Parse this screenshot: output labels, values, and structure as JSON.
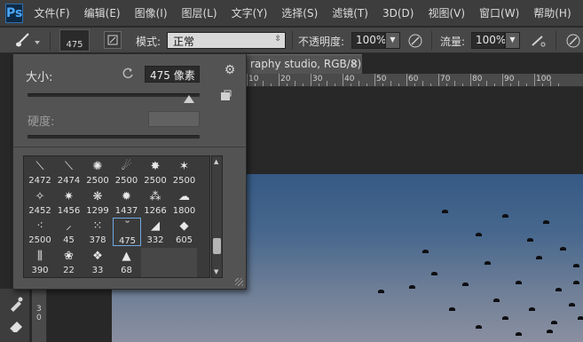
{
  "app": {
    "logo": "Ps"
  },
  "menu": [
    "文件(F)",
    "编辑(E)",
    "图像(I)",
    "图层(L)",
    "文字(Y)",
    "选择(S)",
    "滤镜(T)",
    "3D(D)",
    "视图(V)",
    "窗口(W)",
    "帮助(H)"
  ],
  "options": {
    "brush_size": "475",
    "mode_label": "模式:",
    "mode_value": "正常",
    "opacity_label": "不透明度:",
    "opacity_value": "100%",
    "flow_label": "流量:",
    "flow_value": "100%"
  },
  "document": {
    "tab_title": "raphy studio, RGB/8)",
    "tab_close": "×",
    "ruler_h": [
      "10",
      "20",
      "30",
      "40",
      "50",
      "60",
      "70",
      "80",
      "90",
      "100"
    ],
    "ruler_v": [
      "3",
      "0"
    ]
  },
  "brush_panel": {
    "size_label": "大小:",
    "size_value": "475 像素",
    "size_fraction": 0.94,
    "hardness_label": "硬度:",
    "hardness_fraction": 1.0,
    "gear_icon": "⚙",
    "presets": [
      {
        "num": "2472",
        "icon": "streak-brush-icon",
        "glyph": "⟍"
      },
      {
        "num": "2474",
        "icon": "streak-brush-icon",
        "glyph": "⟍"
      },
      {
        "num": "2500",
        "icon": "splatter-brush-icon",
        "glyph": "✺"
      },
      {
        "num": "2500",
        "icon": "comet-brush-icon",
        "glyph": "☄"
      },
      {
        "num": "2500",
        "icon": "splatter-brush-icon",
        "glyph": "✸"
      },
      {
        "num": "2500",
        "icon": "star-burst-brush-icon",
        "glyph": "✶"
      },
      {
        "num": "2452",
        "icon": "streak-brush-icon",
        "glyph": "✧"
      },
      {
        "num": "1456",
        "icon": "star-burst-brush-icon",
        "glyph": "✷"
      },
      {
        "num": "1299",
        "icon": "splatter-brush-icon",
        "glyph": "❋"
      },
      {
        "num": "1437",
        "icon": "splatter-brush-icon",
        "glyph": "✹"
      },
      {
        "num": "1266",
        "icon": "splatter-brush-icon",
        "glyph": "⁂"
      },
      {
        "num": "1800",
        "icon": "smoke-brush-icon",
        "glyph": "☁"
      },
      {
        "num": "2500",
        "icon": "cloud-brush-icon",
        "glyph": "⁖"
      },
      {
        "num": "45",
        "icon": "feather-brush-icon",
        "glyph": "⸝"
      },
      {
        "num": "378",
        "icon": "birds-brush-icon",
        "glyph": "⁙"
      },
      {
        "num": "475",
        "icon": "birds-brush-icon",
        "glyph": "˘"
      },
      {
        "num": "332",
        "icon": "birds-brush-icon",
        "glyph": "◢"
      },
      {
        "num": "605",
        "icon": "shard-brush-icon",
        "glyph": "◆"
      },
      {
        "num": "390",
        "icon": "grass-brush-icon",
        "glyph": "⫼"
      },
      {
        "num": "22",
        "icon": "leaf-brush-icon",
        "glyph": "❀"
      },
      {
        "num": "33",
        "icon": "shard-brush-icon",
        "glyph": "❖"
      },
      {
        "num": "68",
        "icon": "rock-brush-icon",
        "glyph": "▲"
      }
    ],
    "selected_preset_index": 15
  },
  "colors": {
    "accent": "#6fa8e0",
    "ps_blue": "#4aa8ff"
  }
}
